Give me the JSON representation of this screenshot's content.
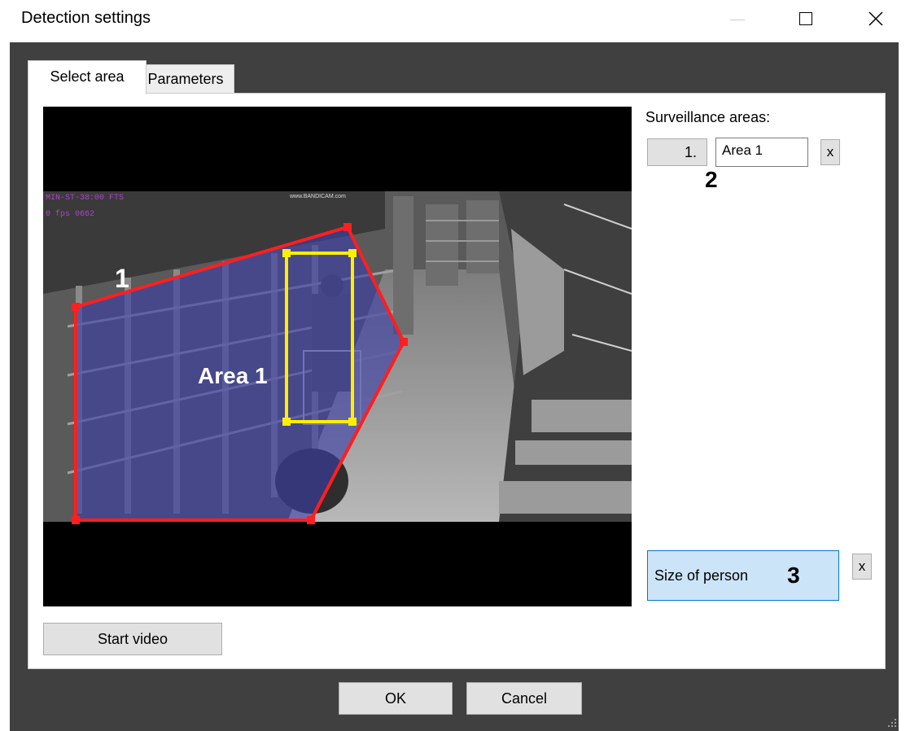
{
  "window": {
    "title": "Detection settings",
    "controls": {
      "minimize": "—",
      "maximize": "☐",
      "close": "✕"
    }
  },
  "tabs": [
    {
      "label": "Select area",
      "active": true
    },
    {
      "label": "Parameters",
      "active": false
    }
  ],
  "video": {
    "area_label": "Area 1",
    "area_number": "1",
    "watermark": "www.BANDICAM.com",
    "overlay_lines": [
      "MIN-ST-38:00 FTS",
      "0 fps   0662"
    ]
  },
  "surveillance": {
    "heading": "Surveillance areas:",
    "items": [
      {
        "index": "1.",
        "name": "Area 1",
        "remove": "x"
      }
    ],
    "marker": "2"
  },
  "size_of_person": {
    "label": "Size of person",
    "marker": "3",
    "remove": "x"
  },
  "buttons": {
    "start_video": "Start video",
    "ok": "OK",
    "cancel": "Cancel"
  },
  "colors": {
    "area_fill": "#3b3ea8",
    "area_outline": "#ff1f1f",
    "person_box": "#ffee00",
    "size_button_bg": "#cce4f7",
    "size_button_border": "#0078d7"
  }
}
